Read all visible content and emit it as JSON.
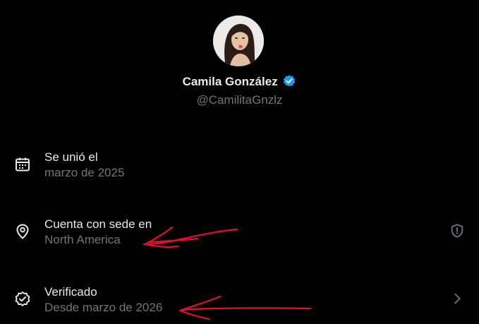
{
  "profile": {
    "name": "Camila González",
    "handle": "@CamilitaGnzlz",
    "verified_badge_icon": "verified-check-icon",
    "accent_color": "#1d9bf0"
  },
  "about": {
    "joined": {
      "label": "Se unió el",
      "value": "marzo de 2025",
      "icon": "calendar-icon"
    },
    "location": {
      "label": "Cuenta con sede en",
      "value": "North America",
      "icon": "location-pin-icon",
      "action_icon": "shield-alert-icon"
    },
    "verified": {
      "label": "Verificado",
      "value": "Desde marzo de 2026",
      "icon": "verified-badge-outline-icon",
      "action_icon": "chevron-right-icon"
    }
  },
  "colors": {
    "background": "#000000",
    "primary_text": "#e7e9ea",
    "secondary_text": "#71767b",
    "annotation_red": "#e0102a"
  }
}
